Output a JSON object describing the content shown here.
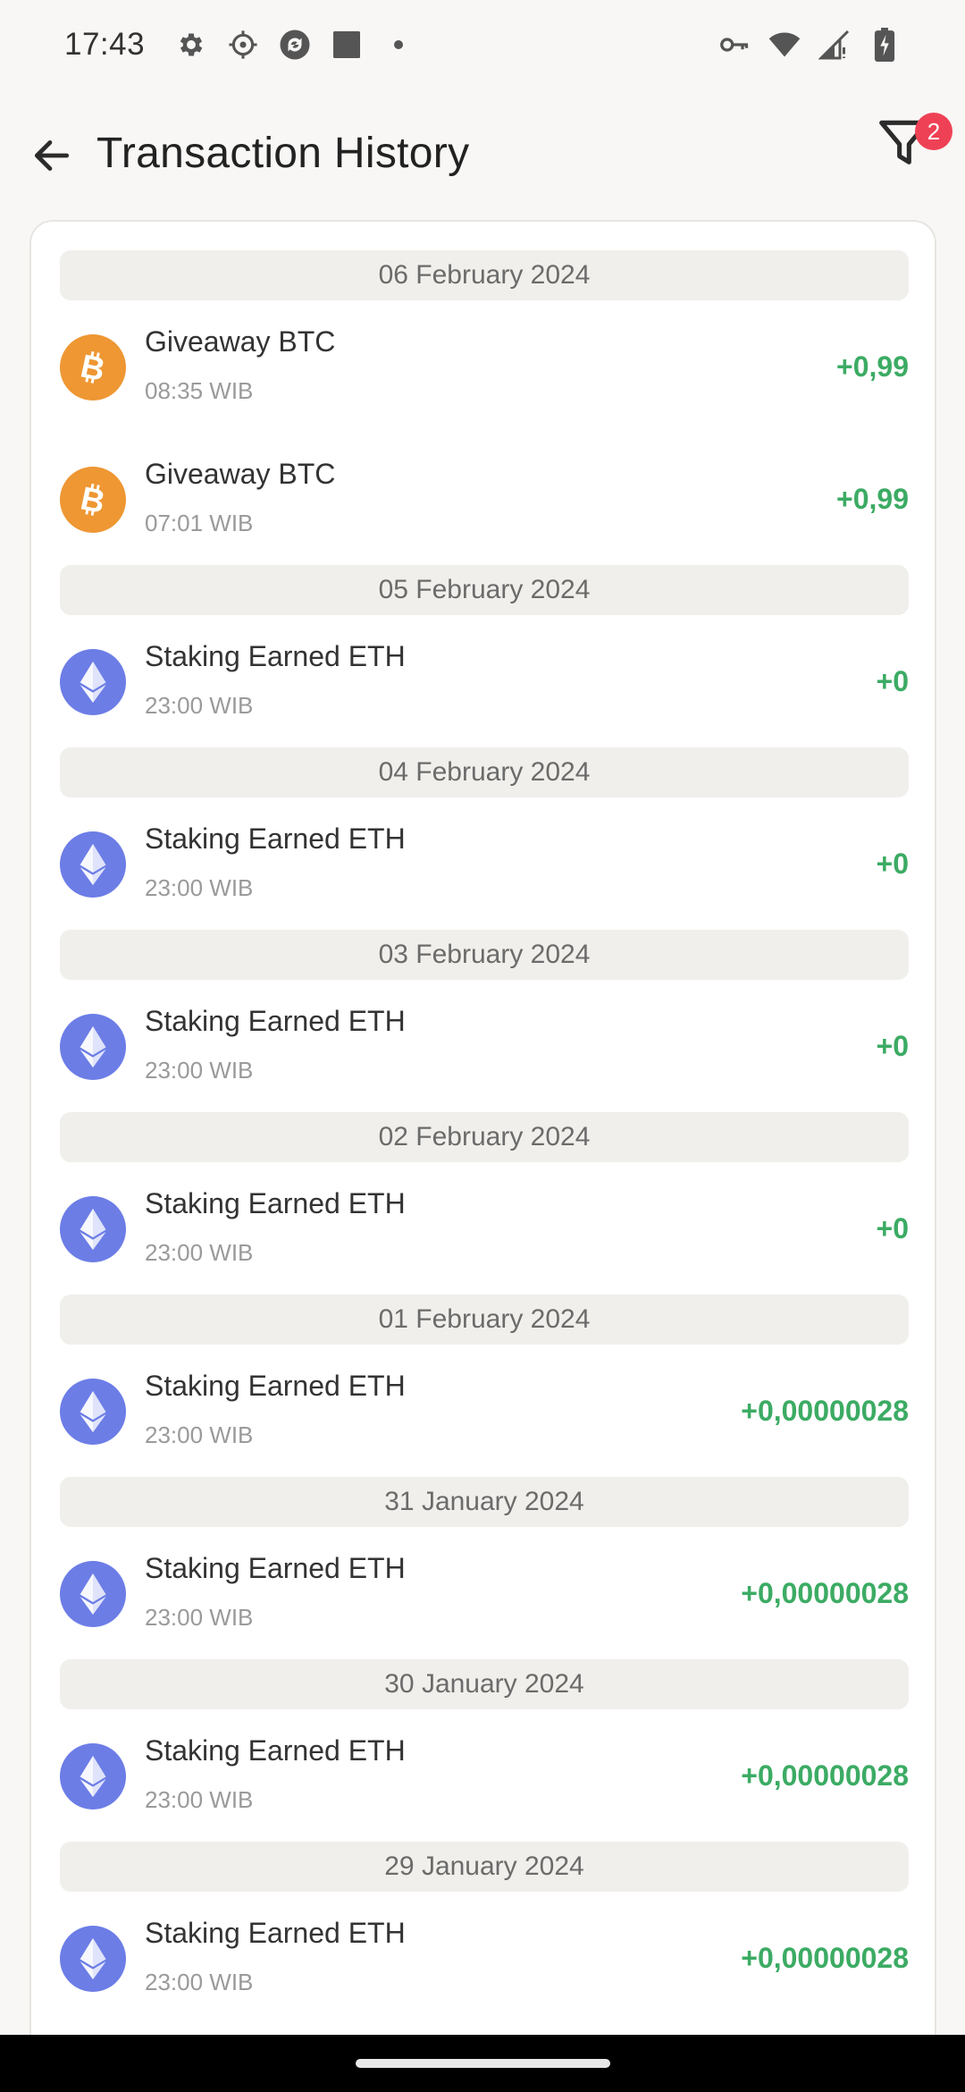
{
  "status_bar": {
    "time": "17:43",
    "left_icons": [
      "gear-icon",
      "crosshair-icon",
      "sync-icon",
      "square-icon",
      "dot-icon"
    ],
    "right_icons": [
      "key-icon",
      "wifi-icon",
      "signal-icon",
      "battery-icon"
    ]
  },
  "header": {
    "title": "Transaction History",
    "filter_badge": "2"
  },
  "colors": {
    "positive": "#3cab64",
    "btc": "#ee9733",
    "eth": "#6c7de6",
    "badge": "#ef4155"
  },
  "groups": [
    {
      "date": "06 February 2024",
      "items": [
        {
          "coin": "btc",
          "title": "Giveaway BTC",
          "time": "08:35 WIB",
          "amount": "+0,99"
        },
        {
          "coin": "btc",
          "title": "Giveaway BTC",
          "time": "07:01 WIB",
          "amount": "+0,99"
        }
      ]
    },
    {
      "date": "05 February 2024",
      "items": [
        {
          "coin": "eth",
          "title": "Staking Earned ETH",
          "time": "23:00 WIB",
          "amount": "+0"
        }
      ]
    },
    {
      "date": "04 February 2024",
      "items": [
        {
          "coin": "eth",
          "title": "Staking Earned ETH",
          "time": "23:00 WIB",
          "amount": "+0"
        }
      ]
    },
    {
      "date": "03 February 2024",
      "items": [
        {
          "coin": "eth",
          "title": "Staking Earned ETH",
          "time": "23:00 WIB",
          "amount": "+0"
        }
      ]
    },
    {
      "date": "02 February 2024",
      "items": [
        {
          "coin": "eth",
          "title": "Staking Earned ETH",
          "time": "23:00 WIB",
          "amount": "+0"
        }
      ]
    },
    {
      "date": "01 February 2024",
      "items": [
        {
          "coin": "eth",
          "title": "Staking Earned ETH",
          "time": "23:00 WIB",
          "amount": "+0,00000028"
        }
      ]
    },
    {
      "date": "31 January 2024",
      "items": [
        {
          "coin": "eth",
          "title": "Staking Earned ETH",
          "time": "23:00 WIB",
          "amount": "+0,00000028"
        }
      ]
    },
    {
      "date": "30 January 2024",
      "items": [
        {
          "coin": "eth",
          "title": "Staking Earned ETH",
          "time": "23:00 WIB",
          "amount": "+0,00000028"
        }
      ]
    },
    {
      "date": "29 January 2024",
      "items": [
        {
          "coin": "eth",
          "title": "Staking Earned ETH",
          "time": "23:00 WIB",
          "amount": "+0,00000028"
        }
      ]
    }
  ]
}
